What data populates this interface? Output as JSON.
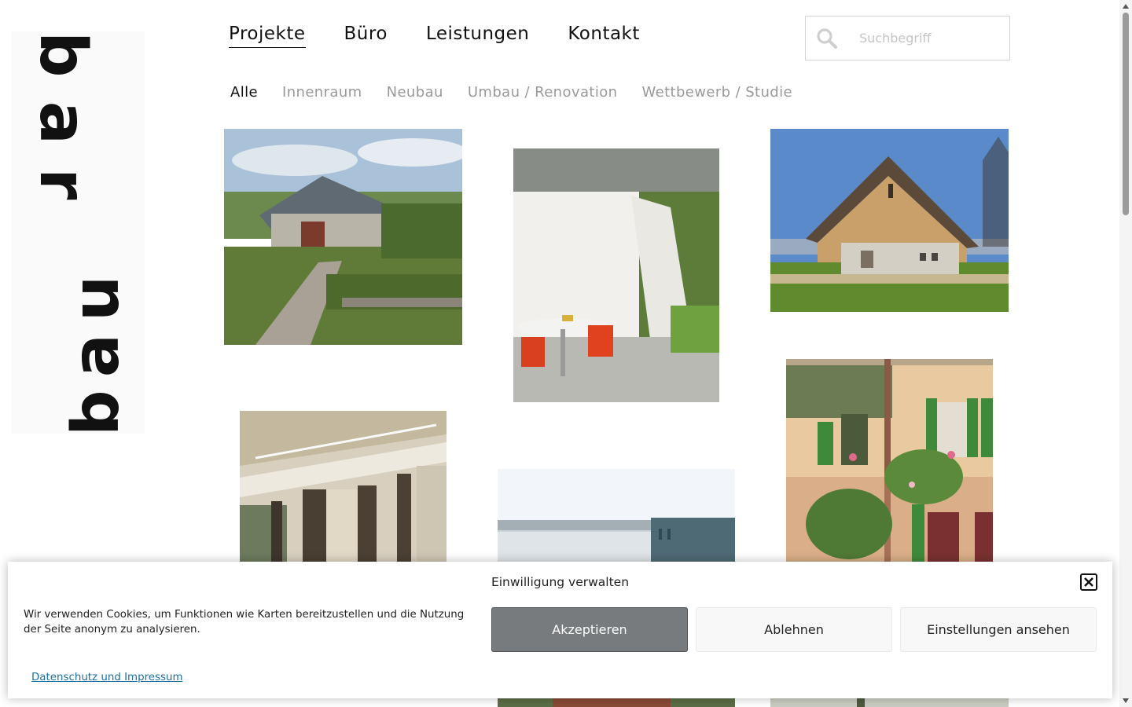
{
  "logo": {
    "part1": "bau",
    "part2": "bar"
  },
  "nav": {
    "items": [
      {
        "label": "Projekte",
        "active": true
      },
      {
        "label": "Büro",
        "active": false
      },
      {
        "label": "Leistungen",
        "active": false
      },
      {
        "label": "Kontakt",
        "active": false
      }
    ]
  },
  "search": {
    "placeholder": "Suchbegriff",
    "value": "",
    "icon": "search-icon"
  },
  "filter": {
    "items": [
      {
        "label": "Alle",
        "active": true
      },
      {
        "label": "Innenraum",
        "active": false
      },
      {
        "label": "Neubau",
        "active": false
      },
      {
        "label": "Umbau / Renovation",
        "active": false
      },
      {
        "label": "Wettbewerb / Studie",
        "active": false
      }
    ]
  },
  "projects": [
    {
      "alt": "Gartenhaus mit Gemüsegarten"
    },
    {
      "alt": "Terrasse mit weissen Vorhängen"
    },
    {
      "alt": "Holzhaus mit Satteldach"
    },
    {
      "alt": "Innenraum mit Deckensegeln"
    },
    {
      "alt": "Modernes Gebäude am See"
    },
    {
      "alt": "Historische Fassade mit grünen Läden"
    }
  ],
  "cookie": {
    "title": "Einwilligung verwalten",
    "text": "Wir verwenden Cookies, um Funktionen wie Karten bereitzustellen und die Nutzung der Seite anonym zu analysieren.",
    "accept": "Akzeptieren",
    "deny": "Ablehnen",
    "settings": "Einstellungen ansehen",
    "link": "Datenschutz und Impressum"
  },
  "colors": {
    "accent_button": "#777b7e",
    "link": "#1d6fa5",
    "muted_text": "#9a9a9a"
  }
}
